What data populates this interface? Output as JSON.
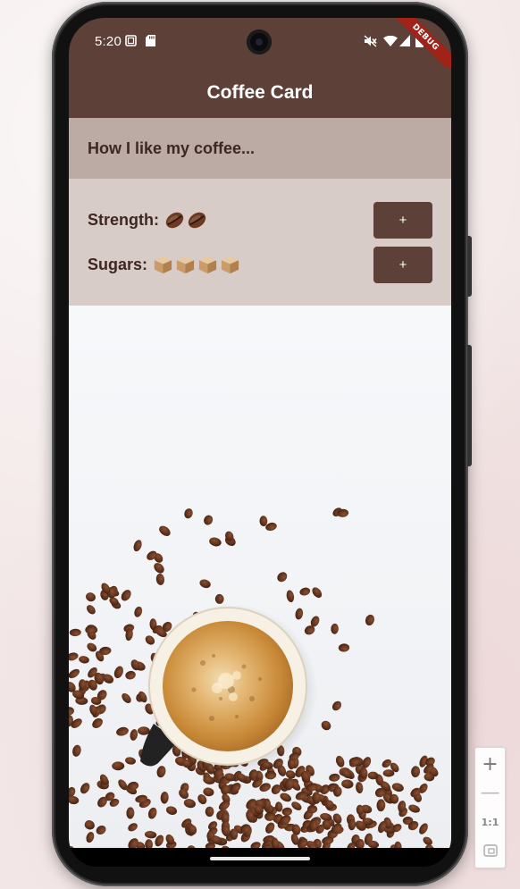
{
  "status_bar": {
    "time": "5:20",
    "debug_banner": "DEBUG"
  },
  "app_bar": {
    "title": "Coffee Card"
  },
  "preferences": {
    "header": "How I like my coffee...",
    "strength": {
      "label": "Strength:",
      "count": 2,
      "icon": "coffee-bean-icon",
      "button_label": "+"
    },
    "sugars": {
      "label": "Sugars:",
      "count": 4,
      "icon": "sugar-cube-icon",
      "button_label": "+"
    }
  },
  "zoom_controls": {
    "zoom_in": "+",
    "zoom_out": "—",
    "actual_size": "1:1"
  },
  "colors": {
    "app_bar": "#5d4037",
    "header_bg": "#bcaaa4",
    "panel_bg": "#d7ccc8",
    "text_dark": "#3e2723",
    "button_bg": "#5d4037"
  }
}
